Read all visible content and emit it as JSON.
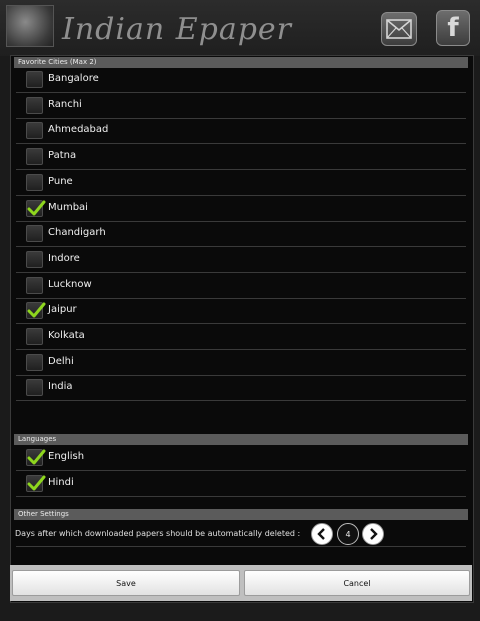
{
  "header": {
    "title": "Indian Epaper"
  },
  "favorites": {
    "heading": "Favorite Cities (Max 2)",
    "items": [
      {
        "label": "Bangalore",
        "checked": false
      },
      {
        "label": "Ranchi",
        "checked": false
      },
      {
        "label": "Ahmedabad",
        "checked": false
      },
      {
        "label": "Patna",
        "checked": false
      },
      {
        "label": "Pune",
        "checked": false
      },
      {
        "label": "Mumbai",
        "checked": true
      },
      {
        "label": "Chandigarh",
        "checked": false
      },
      {
        "label": "Indore",
        "checked": false
      },
      {
        "label": "Lucknow",
        "checked": false
      },
      {
        "label": "Jaipur",
        "checked": true
      },
      {
        "label": "Kolkata",
        "checked": false
      },
      {
        "label": "Delhi",
        "checked": false
      },
      {
        "label": "India",
        "checked": false
      }
    ]
  },
  "languages": {
    "heading": "Languages",
    "items": [
      {
        "label": "English",
        "checked": true
      },
      {
        "label": "Hindi",
        "checked": true
      }
    ]
  },
  "other": {
    "heading": "Other Settings",
    "delete_days_label": "Days after which downloaded papers should be automatically deleted :",
    "delete_days_value": "4"
  },
  "footer": {
    "save_label": "Save",
    "cancel_label": "Cancel"
  },
  "colors": {
    "check": "#8ed61e",
    "section_bar": "#5b5b5b",
    "background": "#0a0a0a"
  },
  "icons": {
    "mail": "mail-icon",
    "facebook": "facebook-icon",
    "checkmark": "checkmark-icon",
    "previous": "chevron-left-icon",
    "next": "chevron-right-icon"
  }
}
